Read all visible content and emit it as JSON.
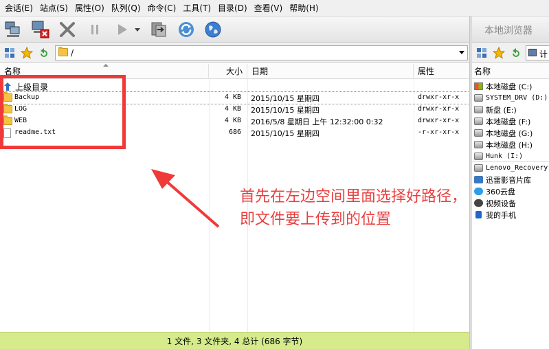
{
  "menu": [
    "会话(E)",
    "站点(S)",
    "属性(O)",
    "队列(Q)",
    "命令(C)",
    "工具(T)",
    "目录(D)",
    "查看(V)",
    "帮助(H)"
  ],
  "toolbar_icons": [
    "connect-icon",
    "disconnect-icon",
    "stop-icon",
    "pause-icon",
    "play-icon",
    "dropdown-icon",
    "sync-icon",
    "refresh-icon",
    "globe-icon"
  ],
  "address": {
    "path": "/"
  },
  "columns": {
    "name": "名称",
    "size": "大小",
    "date": "日期",
    "attr": "属性"
  },
  "parent_dir": "上级目录",
  "files": [
    {
      "name": "Backup",
      "size": "4 KB",
      "date": "2015/10/15 星期四",
      "attr": "drwxr-xr-x",
      "type": "folder"
    },
    {
      "name": "LOG",
      "size": "4 KB",
      "date": "2015/10/15 星期四",
      "attr": "drwxr-xr-x",
      "type": "folder"
    },
    {
      "name": "WEB",
      "size": "4 KB",
      "date": "2016/5/8 星期日 上午 12:32:00 0:32",
      "attr": "drwxr-xr-x",
      "type": "folder"
    },
    {
      "name": "readme.txt",
      "size": "686",
      "date": "2015/10/15 星期四",
      "attr": "-r-xr-xr-x",
      "type": "file"
    }
  ],
  "status": "1 文件, 3 文件夹, 4 总计 (686 字节)",
  "local_browser": {
    "title": "本地浏览器",
    "address_text": "计",
    "column": "名称",
    "items": [
      {
        "label": "本地磁盘 (C:)",
        "icon": "windows-drive-icon"
      },
      {
        "label": "SYSTEM_DRV (D:)",
        "icon": "drive-icon"
      },
      {
        "label": "新盘 (E:)",
        "icon": "drive-icon"
      },
      {
        "label": "本地磁盘 (F:)",
        "icon": "drive-icon"
      },
      {
        "label": "本地磁盘 (G:)",
        "icon": "drive-icon"
      },
      {
        "label": "本地磁盘 (H:)",
        "icon": "drive-icon"
      },
      {
        "label": "Hunk (I:)",
        "icon": "drive-icon"
      },
      {
        "label": "Lenovo_Recovery",
        "icon": "drive-icon"
      },
      {
        "label": "迅雷影音片库",
        "icon": "library-icon"
      },
      {
        "label": "360云盘",
        "icon": "cloud-icon"
      },
      {
        "label": "视频设备",
        "icon": "camera-icon"
      },
      {
        "label": "我的手机",
        "icon": "phone-icon"
      }
    ]
  },
  "annotation": "首先在左边空间里面选择好路径，即文件要上传到的位置",
  "colors": {
    "annotation": "#e84040",
    "status_bg": "#d5eb8c"
  }
}
